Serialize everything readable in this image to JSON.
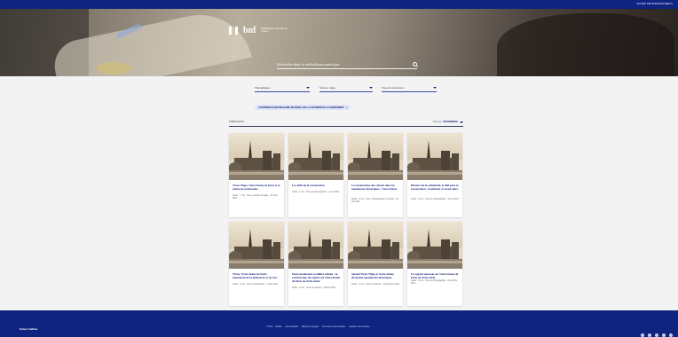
{
  "topbar": {
    "link": "ACCÈS PROFESSIONNELS"
  },
  "hero": {
    "brand_word": "bnf",
    "brand_sub": "Bibliothèque nationale de France",
    "search_placeholder": "Rechercher dans la médiathèque numérique"
  },
  "filters": [
    {
      "label": "Thématiques"
    },
    {
      "label": "Source / date"
    },
    {
      "label": "Type de document"
    }
  ],
  "active_tag": "CATHÉDRALE NOTRE-DAME DE PARIS, DE LA CATHÉDRALE AU MONUMENT",
  "results": {
    "count_label": "8 RÉSULTATS",
    "sort_label": "Trier par",
    "sort_value": "PERTINENCE"
  },
  "cards": [
    {
      "title": "Victor Hugo, Notre-Dame de Paris et la notion de patrimoine",
      "meta": "Article · 7 min · Texte, portrait et images · 12 mars 2021"
    },
    {
      "title": "Les défis de la restauration",
      "meta": "Article · 5 min · Texte et photographies · 4 avril 2021"
    },
    {
      "title": "La restauration des vitraux dans les monuments historiques : Notre-Dame",
      "meta": "Article · 6 min · Texte, photographies et dessins · 20 mai 2021"
    },
    {
      "title": "Histoire de la cathédrale, le défi pour la restauration : matériaux et savoir-faire",
      "meta": "Article · 8 min · Texte et photographies · 15 juin 2021"
    },
    {
      "title": "Victor, Notre-Dame de Paris, monument de la littérature et de l'art",
      "meta": "Article · 5 min · Texte et illustrations · 7 juillet 2021"
    },
    {
      "title": "Entre monument et édifice urbain : la construction du regard sur Notre-Dame de Paris au XIXe siècle",
      "meta": "Article · 9 min · Texte et gravures · 28 août 2021"
    },
    {
      "title": "Quand Victor Hugo et Notre-Dame devinrent monuments historiques",
      "meta": "Article · 6 min · Texte et archives · 9 septembre 2021"
    },
    {
      "title": "Un regard nouveau sur Notre-Dame de Paris au XIXe siècle",
      "meta": "Article · 4 min · Texte et photographies · 21 octobre 2021"
    }
  ],
  "footer": {
    "left_label": "Suivez Gallica",
    "links": [
      "© BnF · Gallica",
      "Accessibilité",
      "Mentions légales",
      "Données personnelles",
      "Gestion des cookies"
    ],
    "social_icons": [
      "facebook-icon",
      "twitter-icon",
      "instagram-icon",
      "youtube-icon",
      "linkedin-icon"
    ]
  },
  "colors": {
    "primary": "#0f2380",
    "link": "#1a237e",
    "background": "#f3f3f3"
  }
}
